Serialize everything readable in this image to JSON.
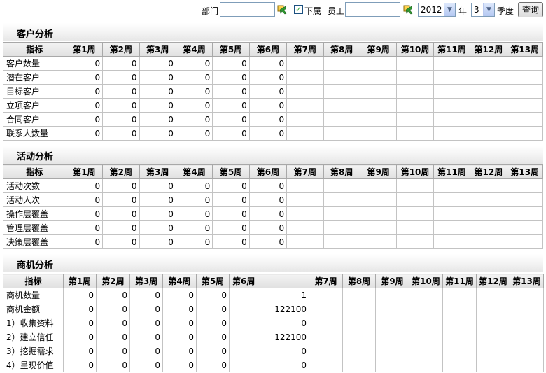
{
  "filters": {
    "dept_label": "部门",
    "dept_value": "",
    "sub_label": "下属",
    "sub_checked": true,
    "employee_label": "员工",
    "employee_value": "",
    "year_value": "2012",
    "year_label": "年",
    "quarter_value": "3",
    "quarter_label": "季度",
    "query_label": "查询"
  },
  "week_headers": [
    "第1周",
    "第2周",
    "第3周",
    "第4周",
    "第5周",
    "第6周",
    "第7周",
    "第8周",
    "第9周",
    "第10周",
    "第11周",
    "第12周",
    "第13周"
  ],
  "sections": [
    {
      "title": "客户分析",
      "index_header": "指标",
      "rows": [
        {
          "name": "客户数量",
          "values": [
            "0",
            "0",
            "0",
            "0",
            "0",
            "0",
            "",
            "",
            "",
            "",
            "",
            "",
            ""
          ]
        },
        {
          "name": "潜在客户",
          "values": [
            "0",
            "0",
            "0",
            "0",
            "0",
            "0",
            "",
            "",
            "",
            "",
            "",
            "",
            ""
          ]
        },
        {
          "name": "目标客户",
          "values": [
            "0",
            "0",
            "0",
            "0",
            "0",
            "0",
            "",
            "",
            "",
            "",
            "",
            "",
            ""
          ]
        },
        {
          "name": "立项客户",
          "values": [
            "0",
            "0",
            "0",
            "0",
            "0",
            "0",
            "",
            "",
            "",
            "",
            "",
            "",
            ""
          ]
        },
        {
          "name": "合同客户",
          "values": [
            "0",
            "0",
            "0",
            "0",
            "0",
            "0",
            "",
            "",
            "",
            "",
            "",
            "",
            ""
          ]
        },
        {
          "name": "联系人数量",
          "values": [
            "0",
            "0",
            "0",
            "0",
            "0",
            "0",
            "",
            "",
            "",
            "",
            "",
            "",
            ""
          ]
        }
      ]
    },
    {
      "title": "活动分析",
      "index_header": "指标",
      "rows": [
        {
          "name": "活动次数",
          "values": [
            "0",
            "0",
            "0",
            "0",
            "0",
            "0",
            "",
            "",
            "",
            "",
            "",
            "",
            ""
          ]
        },
        {
          "name": "活动人次",
          "values": [
            "0",
            "0",
            "0",
            "0",
            "0",
            "0",
            "",
            "",
            "",
            "",
            "",
            "",
            ""
          ]
        },
        {
          "name": "操作层覆盖",
          "values": [
            "0",
            "0",
            "0",
            "0",
            "0",
            "0",
            "",
            "",
            "",
            "",
            "",
            "",
            ""
          ]
        },
        {
          "name": "管理层覆盖",
          "values": [
            "0",
            "0",
            "0",
            "0",
            "0",
            "0",
            "",
            "",
            "",
            "",
            "",
            "",
            ""
          ]
        },
        {
          "name": "决策层覆盖",
          "values": [
            "0",
            "0",
            "0",
            "0",
            "0",
            "0",
            "",
            "",
            "",
            "",
            "",
            "",
            ""
          ]
        }
      ]
    },
    {
      "title": "商机分析",
      "index_header": "指标",
      "rows": [
        {
          "name": "商机数量",
          "values": [
            "0",
            "0",
            "0",
            "0",
            "0",
            "1",
            "",
            "",
            "",
            "",
            "",
            "",
            ""
          ]
        },
        {
          "name": "商机金额",
          "values": [
            "0",
            "0",
            "0",
            "0",
            "0",
            "122100",
            "",
            "",
            "",
            "",
            "",
            "",
            ""
          ]
        },
        {
          "name": "1）收集资料",
          "values": [
            "0",
            "0",
            "0",
            "0",
            "0",
            "0",
            "",
            "",
            "",
            "",
            "",
            "",
            ""
          ]
        },
        {
          "name": "2）建立信任",
          "values": [
            "0",
            "0",
            "0",
            "0",
            "0",
            "122100",
            "",
            "",
            "",
            "",
            "",
            "",
            ""
          ]
        },
        {
          "name": "3）挖掘需求",
          "values": [
            "0",
            "0",
            "0",
            "0",
            "0",
            "0",
            "",
            "",
            "",
            "",
            "",
            "",
            ""
          ]
        },
        {
          "name": "4）呈现价值",
          "values": [
            "0",
            "0",
            "0",
            "0",
            "0",
            "0",
            "",
            "",
            "",
            "",
            "",
            "",
            ""
          ]
        }
      ]
    }
  ]
}
